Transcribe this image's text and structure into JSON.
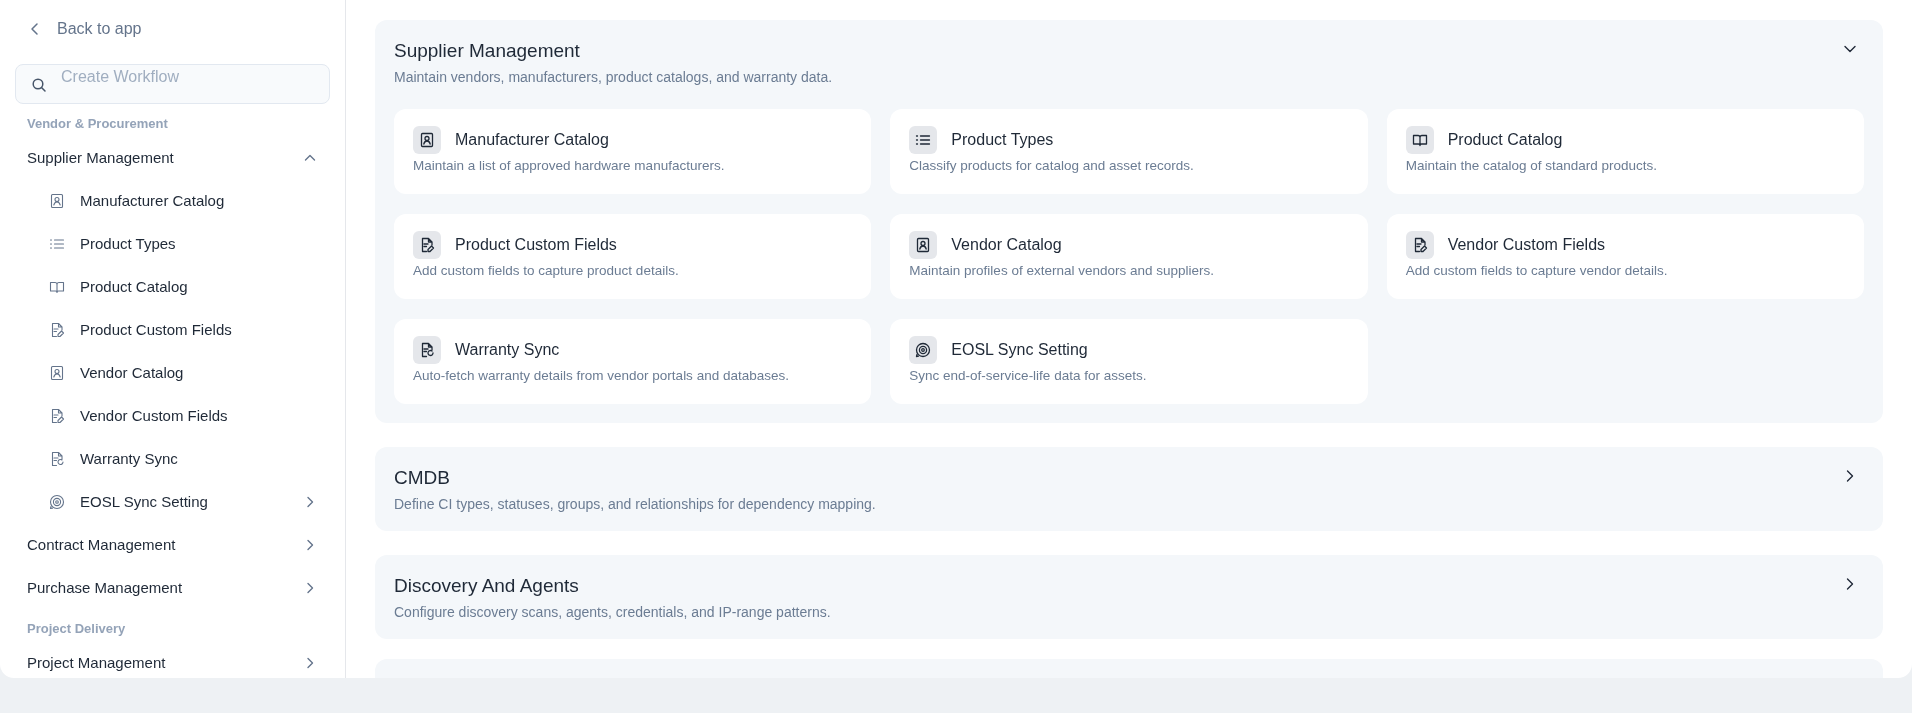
{
  "sidebar": {
    "back_link": "Back to app",
    "search": {
      "placeholder": "Create Workflow"
    },
    "groups": [
      {
        "heading": "Vendor & Procurement",
        "items": [
          {
            "label": "Supplier Management",
            "expanded": true,
            "children": [
              {
                "label": "Manufacturer Catalog",
                "kind": "contact",
                "expandable": false
              },
              {
                "label": "Product Types",
                "kind": "list",
                "expandable": false
              },
              {
                "label": "Product Catalog",
                "kind": "book",
                "expandable": false
              },
              {
                "label": "Product Custom Fields",
                "kind": "file-edit",
                "expandable": false
              },
              {
                "label": "Vendor Catalog",
                "kind": "contact",
                "expandable": false
              },
              {
                "label": "Vendor Custom Fields",
                "kind": "file-edit",
                "expandable": false
              },
              {
                "label": "Warranty Sync",
                "kind": "file-sync",
                "expandable": false
              },
              {
                "label": "EOSL Sync Setting",
                "kind": "gear-sync",
                "expandable": true
              }
            ]
          },
          {
            "label": "Contract Management",
            "expanded": false
          },
          {
            "label": "Purchase Management",
            "expanded": false
          }
        ]
      },
      {
        "heading": "Project Delivery",
        "items": [
          {
            "label": "Project Management",
            "expanded": false
          }
        ]
      }
    ]
  },
  "sections": [
    {
      "title": "Supplier Management",
      "description": "Maintain vendors, manufacturers, product catalogs, and warranty data.",
      "expanded": true,
      "tiles": [
        {
          "kind": "contact",
          "title": "Manufacturer Catalog",
          "description": "Maintain a list of approved hardware manufacturers."
        },
        {
          "kind": "list",
          "title": "Product Types",
          "description": "Classify products for catalog and asset records."
        },
        {
          "kind": "book",
          "title": "Product Catalog",
          "description": "Maintain the catalog of standard products."
        },
        {
          "kind": "file-edit",
          "title": "Product Custom Fields",
          "description": "Add custom fields to capture product details."
        },
        {
          "kind": "contact",
          "title": "Vendor Catalog",
          "description": "Maintain profiles of external vendors and suppliers."
        },
        {
          "kind": "file-edit",
          "title": "Vendor Custom Fields",
          "description": "Add custom fields to capture vendor details."
        },
        {
          "kind": "file-sync",
          "title": "Warranty Sync",
          "description": "Auto-fetch warranty details from vendor portals and databases."
        },
        {
          "kind": "gear-sync",
          "title": "EOSL Sync Setting",
          "description": "Sync end-of-service-life data for assets."
        }
      ]
    },
    {
      "title": "CMDB",
      "description": "Define CI types, statuses, groups, and relationships for dependency mapping.",
      "expanded": false
    },
    {
      "title": "Discovery And Agents",
      "description": "Configure discovery scans, agents, credentials, and IP-range patterns.",
      "expanded": false
    }
  ]
}
